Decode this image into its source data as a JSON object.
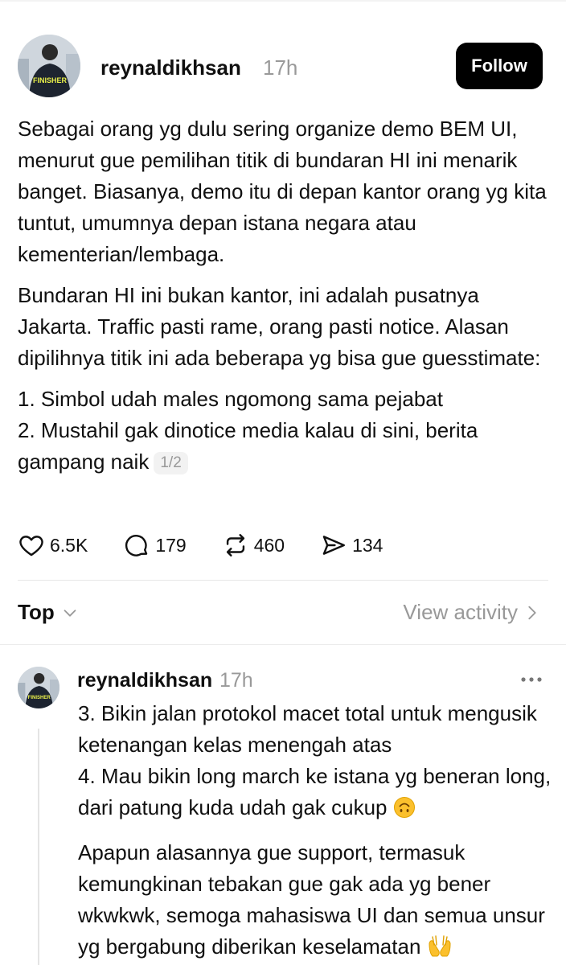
{
  "post": {
    "username": "reynaldikhsan",
    "time": "17h",
    "follow_label": "Follow",
    "paragraphs": [
      "Sebagai orang yg dulu sering organize demo BEM UI, menurut gue pemilihan titik di bundaran HI ini menarik banget. Biasanya, demo itu di depan kantor orang yg kita tuntut, umumnya depan istana negara atau kementerian/lembaga.",
      "Bundaran HI ini bukan kantor, ini adalah pusatnya Jakarta. Traffic pasti rame, orang pasti notice. Alasan dipilihnya titik ini ada beberapa yg bisa gue guesstimate:"
    ],
    "list_line_1": "1. Simbol udah males ngomong sama pejabat",
    "list_line_2": "2. Mustahil gak dinotice media kalau di sini, berita gampang naik",
    "page_indicator": "1/2",
    "stats": {
      "likes": "6.5K",
      "comments": "179",
      "reposts": "460",
      "shares": "134"
    }
  },
  "sort": {
    "label": "Top",
    "view_activity": "View activity"
  },
  "reply": {
    "username": "reynaldikhsan",
    "time": "17h",
    "lines": [
      "3. Bikin jalan protokol macet total untuk mengusik ketenangan kelas menengah atas",
      "4. Mau bikin long march ke istana yg beneran long, dari patung kuda udah gak cukup"
    ],
    "paragraph": "Apapun alasannya gue support, termasuk kemungkinan tebakan gue gak ada yg bener wkwkwk, semoga mahasiswa UI dan semua unsur yg bergabung diberikan keselamatan"
  },
  "avatar_badge_text": "FINISHER",
  "colors": {
    "text": "#101010",
    "muted": "#999999",
    "button": "#000000",
    "divider": "#e6e6e6"
  },
  "icons": [
    "heart-icon",
    "comment-icon",
    "repost-icon",
    "share-icon",
    "chevron-down-icon",
    "chevron-right-icon",
    "more-icon"
  ]
}
